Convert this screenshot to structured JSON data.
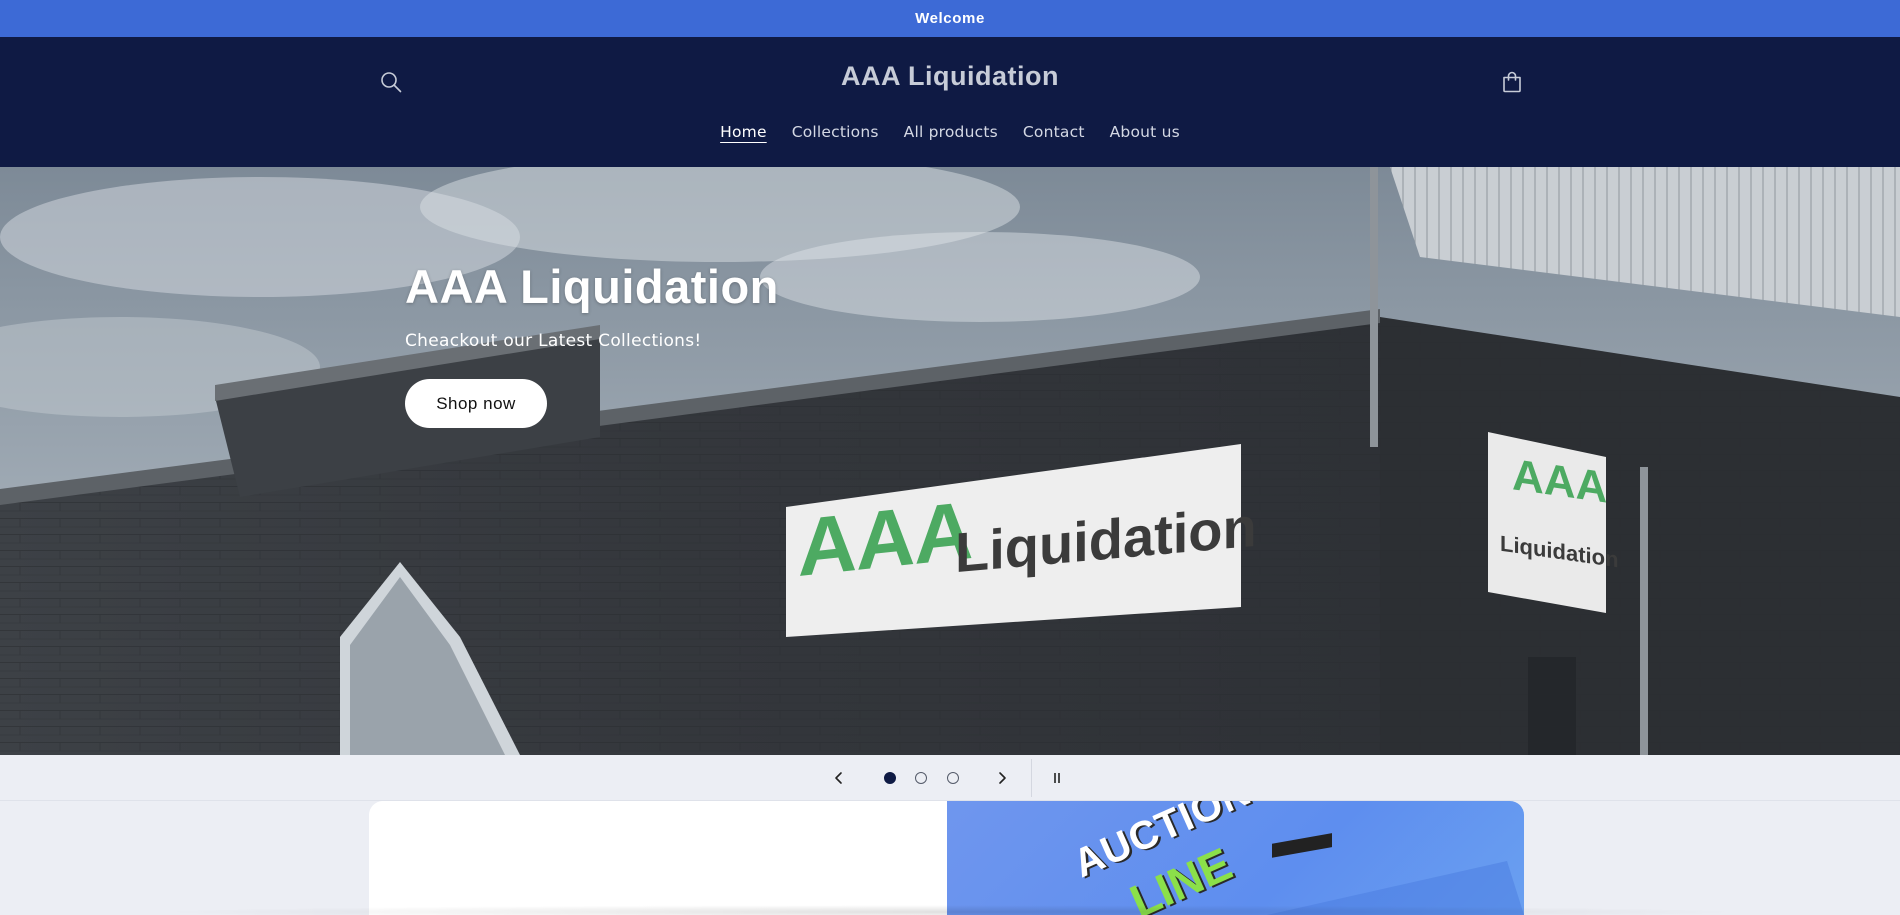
{
  "announcement": {
    "text": "Welcome"
  },
  "header": {
    "brand": "AAA Liquidation",
    "nav": [
      {
        "label": "Home",
        "active": true
      },
      {
        "label": "Collections",
        "active": false
      },
      {
        "label": "All products",
        "active": false
      },
      {
        "label": "Contact",
        "active": false
      },
      {
        "label": "About us",
        "active": false
      }
    ],
    "icons": {
      "search": "search-icon",
      "cart": "cart-icon"
    }
  },
  "hero": {
    "title": "AAA Liquidation",
    "subtitle": "Cheackout our Latest Collections!",
    "button_label": "Shop now",
    "sign_text_left": "AAA",
    "sign_text_right": "Liquidation",
    "small_sign_top": "AAA",
    "small_sign_bottom": "Liquidation"
  },
  "slider": {
    "slides_count": 3,
    "active_index": 0,
    "icons": {
      "prev": "chevron-left-icon",
      "next": "chevron-right-icon",
      "pause": "pause-icon"
    }
  },
  "promo": {
    "graphic_text_1": "AUCTION",
    "graphic_text_2": "LINE"
  },
  "colors": {
    "announcement_bg": "#3d6ad6",
    "header_bg": "#0f1a44",
    "page_bg": "#eceef4",
    "sign_green": "#4daa62",
    "promo_blue": "#5e8eef"
  }
}
